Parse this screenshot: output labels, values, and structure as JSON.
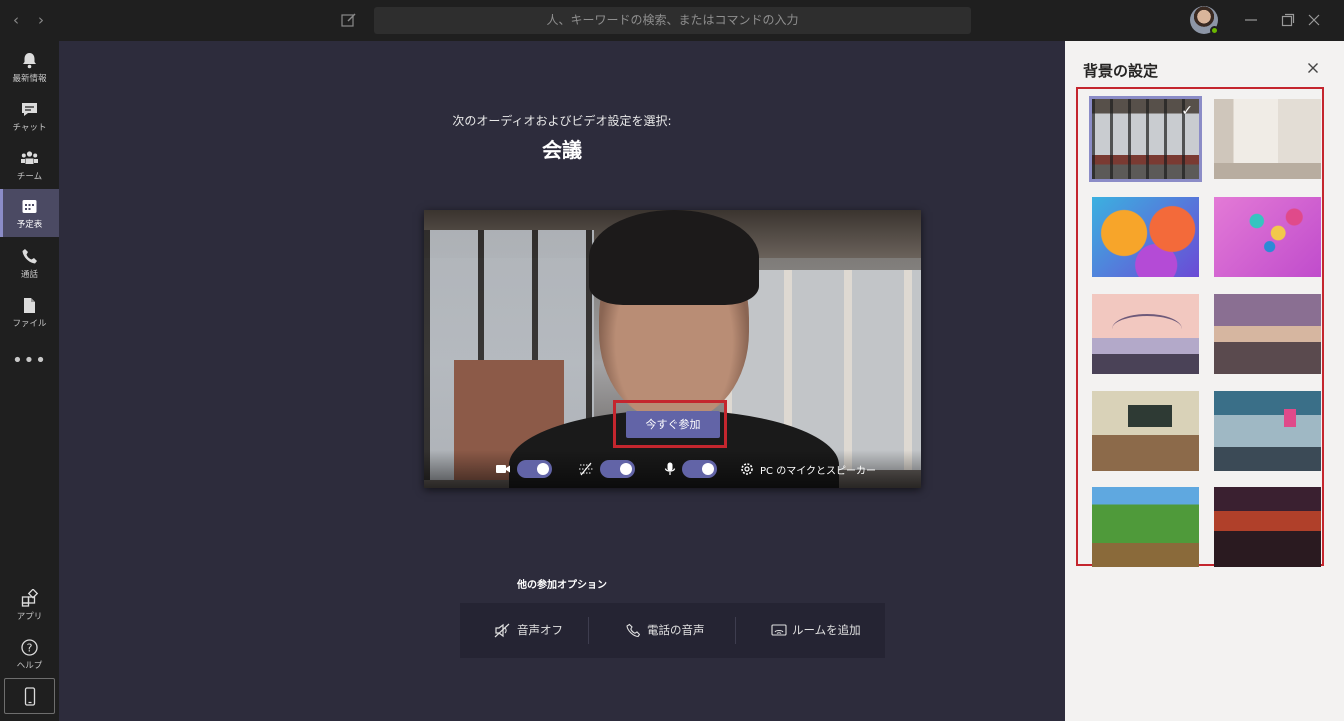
{
  "titlebar": {
    "search_placeholder": "人、キーワードの検索、またはコマンドの入力"
  },
  "rail": {
    "items": [
      {
        "label": "最新情報",
        "icon": "bell-icon"
      },
      {
        "label": "チャット",
        "icon": "chat-icon"
      },
      {
        "label": "チーム",
        "icon": "teams-icon"
      },
      {
        "label": "予定表",
        "icon": "calendar-icon",
        "active": true
      },
      {
        "label": "通話",
        "icon": "phone-icon"
      },
      {
        "label": "ファイル",
        "icon": "file-icon"
      }
    ],
    "more": "•••",
    "bottom": [
      {
        "label": "アプリ",
        "icon": "apps-icon"
      },
      {
        "label": "ヘルプ",
        "icon": "help-icon"
      }
    ]
  },
  "main": {
    "prompt": "次のオーディオおよびビデオ設定を選択:",
    "meeting_title": "会議",
    "join_label": "今すぐ参加",
    "audio_device_label": "PC のマイクとスピーカー",
    "toggles": {
      "camera": true,
      "background_blur": true,
      "microphone": true
    },
    "other_options_title": "他の参加オプション",
    "other_options": [
      {
        "label": "音声オフ",
        "icon": "speaker-off-icon"
      },
      {
        "label": "電話の音声",
        "icon": "phone-icon"
      },
      {
        "label": "ルームを追加",
        "icon": "cast-icon"
      }
    ]
  },
  "panel": {
    "title": "背景の設定",
    "backgrounds": [
      {
        "name": "office-room",
        "selected": true
      },
      {
        "name": "white-room"
      },
      {
        "name": "orange-balloons"
      },
      {
        "name": "pink-balloons"
      },
      {
        "name": "bridge"
      },
      {
        "name": "mountain-landscape"
      },
      {
        "name": "classroom"
      },
      {
        "name": "sci-fi-interior"
      },
      {
        "name": "minecraft-green"
      },
      {
        "name": "minecraft-red"
      }
    ]
  },
  "colors": {
    "accent": "#6264a7",
    "highlight_red": "#c4262e",
    "rail_bg": "#1f1f1f",
    "main_bg": "#2d2c3c",
    "panel_bg": "#f3f2f1"
  }
}
